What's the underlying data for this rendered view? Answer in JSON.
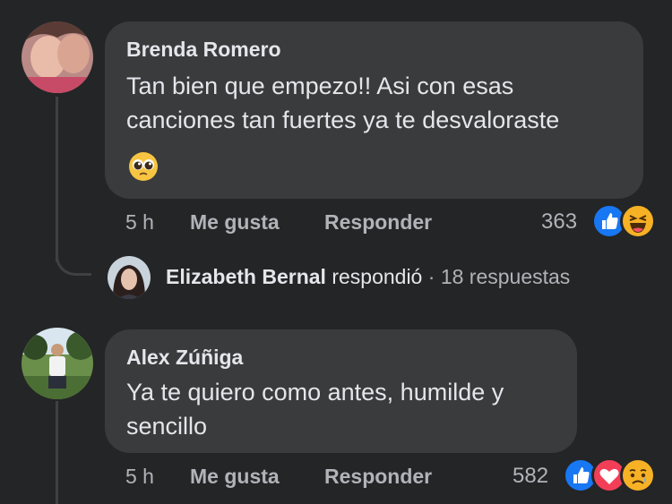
{
  "comments": [
    {
      "author": "Brenda Romero",
      "text_line1": "Tan bien que empezo!! Asi con esas",
      "text_line2": "canciones tan fuertes ya te desvaloraste",
      "emoji": "🥺",
      "time": "5 h",
      "like_label": "Me gusta",
      "reply_label": "Responder",
      "reaction_count": "363",
      "reactions": [
        "like-icon",
        "haha-icon"
      ]
    },
    {
      "author": "Alex Zúñiga",
      "text_line1": "Ya te quiero como antes, humilde y",
      "text_line2": "sencillo",
      "time": "5 h",
      "like_label": "Me gusta",
      "reply_label": "Responder",
      "reaction_count": "582",
      "reactions": [
        "like-icon",
        "love-icon",
        "sad-icon"
      ]
    }
  ],
  "reply_summary": {
    "name": "Elizabeth Bernal",
    "action": "respondió",
    "separator": "·",
    "count": "18 respuestas"
  },
  "colors": {
    "background": "#242526",
    "bubble": "#3a3b3c",
    "like_blue": "#1877f2",
    "love_red": "#f33e58",
    "haha_yellow": "#f7b125"
  }
}
